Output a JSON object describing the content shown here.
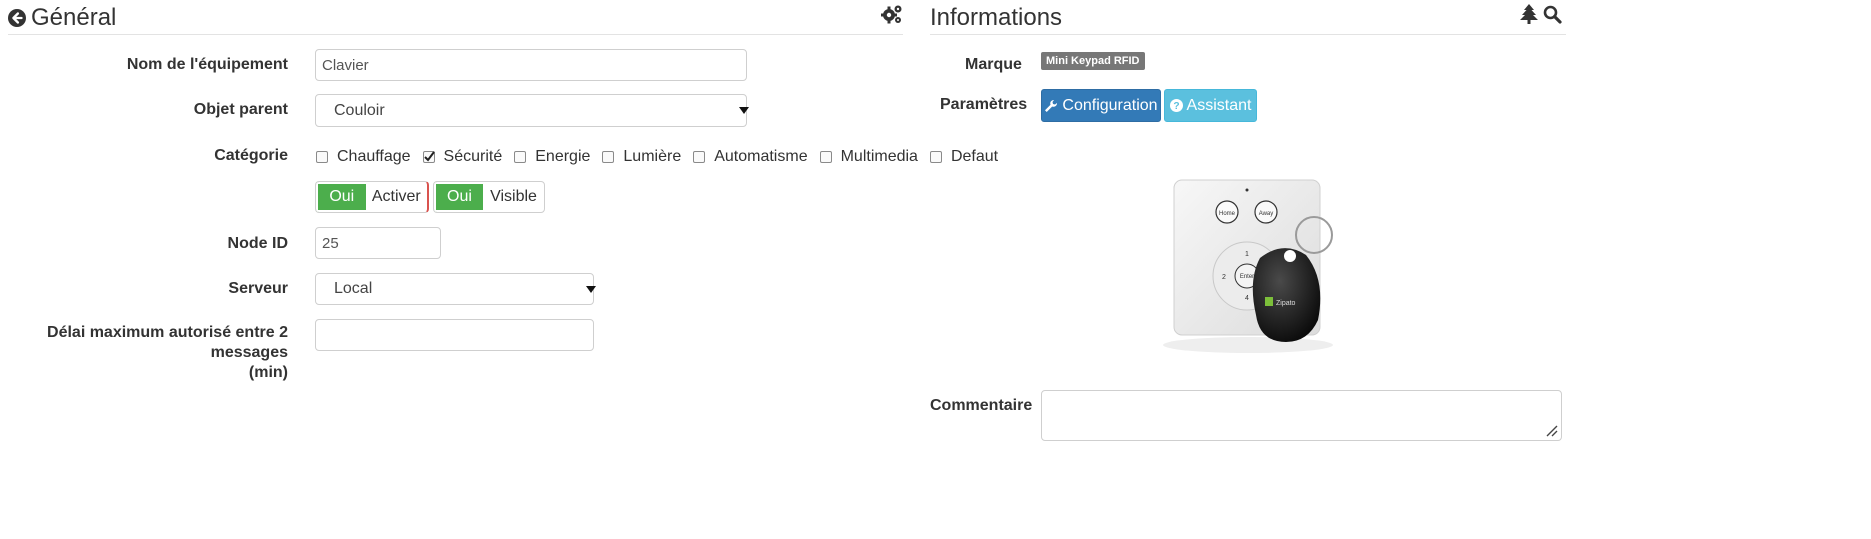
{
  "general": {
    "title": "Général",
    "fields": {
      "name_label": "Nom de l'équipement",
      "name_value": "Clavier",
      "parent_label": "Objet parent",
      "parent_value": "Couloir",
      "category_label": "Catégorie",
      "node_label": "Node ID",
      "node_value": "25",
      "server_label": "Serveur",
      "server_value": "Local",
      "delay_label_line1": "Délai maximum autorisé entre 2 messages",
      "delay_label_line2": "(min)",
      "delay_value": ""
    },
    "categories": [
      {
        "label": "Chauffage",
        "checked": false
      },
      {
        "label": "Sécurité",
        "checked": true
      },
      {
        "label": "Energie",
        "checked": false
      },
      {
        "label": "Lumière",
        "checked": false
      },
      {
        "label": "Automatisme",
        "checked": false
      },
      {
        "label": "Multimedia",
        "checked": false
      },
      {
        "label": "Defaut",
        "checked": false
      }
    ],
    "toggles": {
      "activate_on": "Oui",
      "activate_label": "Activer",
      "visible_on": "Oui",
      "visible_label": "Visible"
    },
    "header_icon": "back-circle-icon",
    "settings_icon": "gears-icon"
  },
  "informations": {
    "title": "Informations",
    "brand_label": "Marque",
    "brand_badge": "Mini Keypad RFID",
    "params_label": "Paramètres",
    "config_button": "Configuration",
    "assistant_button": "Assistant",
    "comment_label": "Commentaire",
    "comment_value": "",
    "product_image": "mini-keypad-rfid-photo",
    "keypad_buttons": [
      "Home",
      "Away",
      "1",
      "2",
      "Enter",
      "4"
    ],
    "keyfob_brand": "Zipato",
    "tree_icon": "tree-icon",
    "search_icon": "search-icon"
  },
  "colors": {
    "toggle_on": "#4cae4c",
    "primary": "#337ab7",
    "info": "#5bc0de",
    "badge": "#777777"
  }
}
